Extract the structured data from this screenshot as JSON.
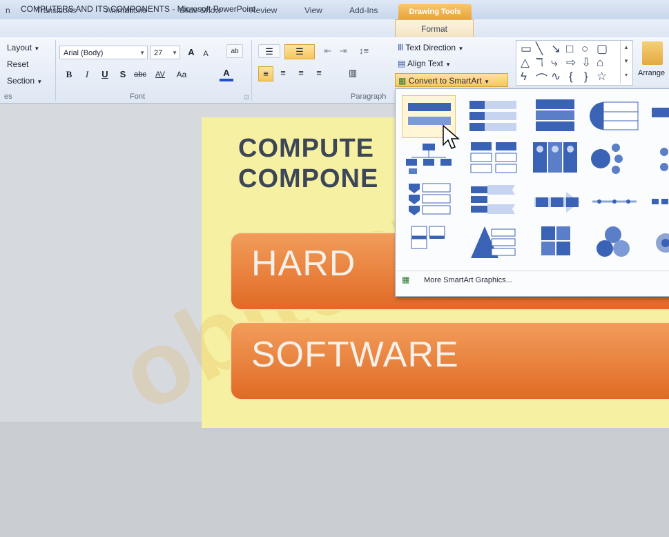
{
  "window": {
    "title": "COMPUTERS AND ITS COMPONENTS  -  Microsoft PowerPoint",
    "contextual_tab": "Drawing Tools"
  },
  "tabs": [
    "n",
    "Transitions",
    "Animations",
    "Slide Show",
    "Review",
    "View",
    "Add-Ins",
    "Format"
  ],
  "ribbon": {
    "slides_group": {
      "layout": "Layout",
      "reset": "Reset",
      "section": "Section",
      "label": "es"
    },
    "font_group": {
      "font_name": "Arial (Body)",
      "font_size": "27",
      "label": "Font",
      "bold": "B",
      "italic": "I",
      "underline": "U",
      "shadow": "S",
      "strike": "abc",
      "spacing": "AV",
      "case": "Aa",
      "color": "A",
      "grow": "A",
      "shrink": "A"
    },
    "paragraph_group": {
      "label": "Paragraph"
    },
    "text_direction": "Text Direction",
    "align_text": "Align Text",
    "convert_smartart": "Convert to SmartArt",
    "arrange": "Arrange"
  },
  "slide": {
    "title_line1": "COMPUTE",
    "title_line2": "COMPONE",
    "box1": "HARD",
    "box2": "SOFTWARE",
    "watermark": "obitect Aca"
  },
  "gallery": {
    "more_link": "More SmartArt Graphics..."
  },
  "colors": {
    "slide_bg": "#f6f0a3",
    "orange": "#e8782f",
    "accent_blue": "#2f5597"
  }
}
